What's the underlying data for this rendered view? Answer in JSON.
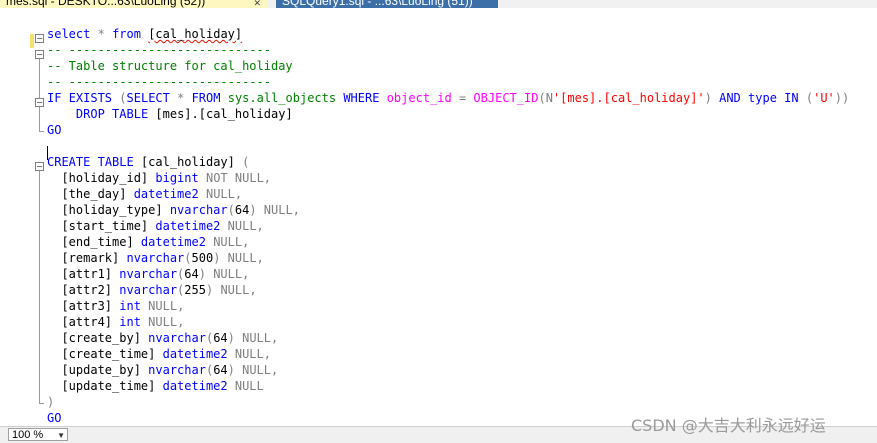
{
  "tabs": [
    {
      "label": "mes.sql - DESKTO...63\\LuoLing (52))",
      "close": "✕"
    },
    {
      "label": "SQLQuery1.sql - ...63\\LuoLing (51))"
    }
  ],
  "editor": {
    "lines": [
      "select * from [cal_holiday]",
      "-- ----------------------------",
      "-- Table structure for cal_holiday",
      "-- ----------------------------",
      "IF EXISTS (SELECT * FROM sys.all_objects WHERE object_id = OBJECT_ID(N'[mes].[cal_holiday]') AND type IN ('U'))",
      "    DROP TABLE [mes].[cal_holiday]",
      "GO",
      "",
      "CREATE TABLE [cal_holiday] (",
      "  [holiday_id] bigint NOT NULL,",
      "  [the_day] datetime2 NULL,",
      "  [holiday_type] nvarchar(64) NULL,",
      "  [start_time] datetime2 NULL,",
      "  [end_time] datetime2 NULL,",
      "  [remark] nvarchar(500) NULL,",
      "  [attr1] nvarchar(64) NULL,",
      "  [attr2] nvarchar(255) NULL,",
      "  [attr3] int NULL,",
      "  [attr4] int NULL,",
      "  [create_by] nvarchar(64) NULL,",
      "  [create_time] datetime2 NULL,",
      "  [update_by] nvarchar(64) NULL,",
      "  [update_time] datetime2 NULL",
      ")",
      "GO"
    ]
  },
  "statusbar": {
    "zoom": "100 %"
  },
  "watermark": "CSDN @大吉大利永远好运"
}
